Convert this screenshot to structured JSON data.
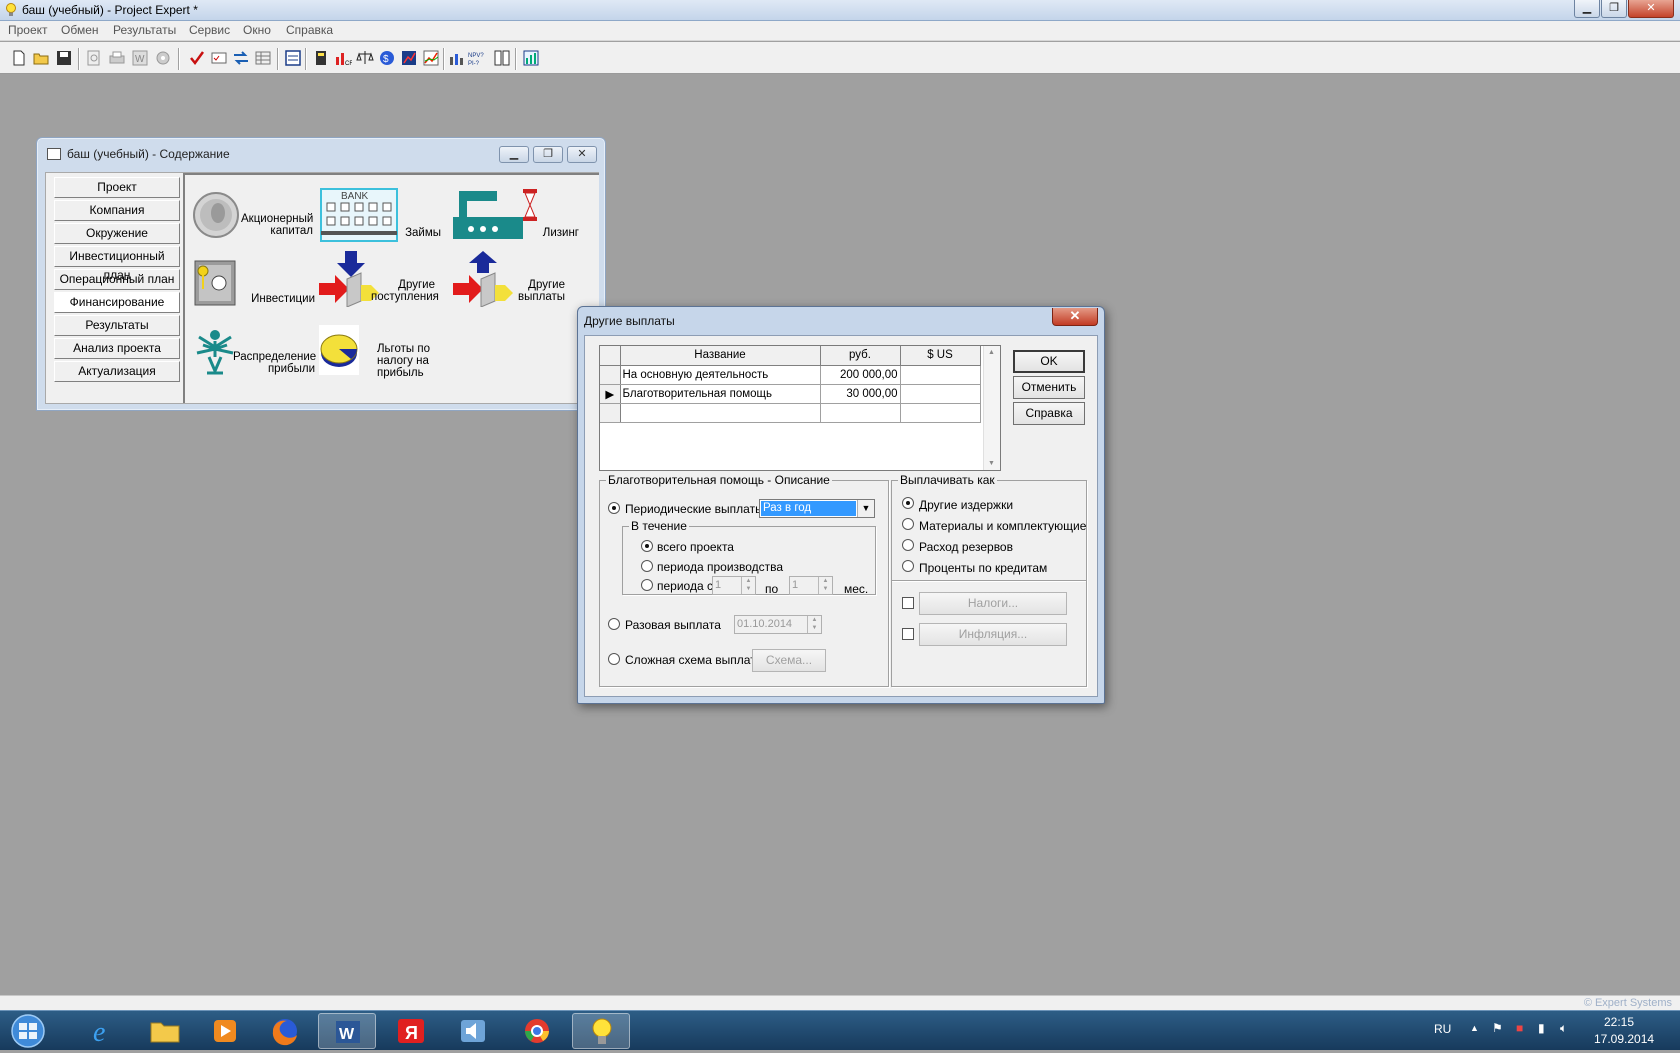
{
  "app": {
    "title": "баш (учебный) - Project Expert *",
    "menu": [
      "Проект",
      "Обмен",
      "Результаты",
      "Сервис",
      "Окно",
      "Справка"
    ],
    "copyright": "© Expert Systems"
  },
  "content_window": {
    "title": "баш (учебный) - Содержание",
    "nav": [
      "Проект",
      "Компания",
      "Окружение",
      "Инвестиционный план",
      "Операционный план",
      "Финансирование",
      "Результаты",
      "Анализ проекта",
      "Актуализация"
    ],
    "active_nav": "Финансирование",
    "tiles": {
      "equity": "Акционерный капитал",
      "loans": "Займы",
      "leasing": "Лизинг",
      "investments": "Инвестиции",
      "other_income": "Другие поступления",
      "other_payments": "Другие выплаты",
      "profit_distribution": "Распределение прибыли",
      "tax_benefits": "Льготы по налогу на прибыль"
    }
  },
  "dialog": {
    "title": "Другие выплаты",
    "grid": {
      "headers": [
        "Название",
        "руб.",
        "$ US"
      ],
      "rows": [
        {
          "name": "На основную деятельность",
          "rub": "200 000,00",
          "usd": ""
        },
        {
          "name": "Благотворительная помощь",
          "rub": "30 000,00",
          "usd": ""
        }
      ],
      "selected_row": 1
    },
    "buttons": {
      "ok": "OK",
      "cancel": "Отменить",
      "help": "Справка"
    },
    "description": {
      "legend": "Благотворительная помощь - Описание",
      "periodic_label": "Периодические выплаты",
      "periodic_value": "Раз в год",
      "periodic_checked": true,
      "during_legend": "В течение",
      "whole_project": "всего проекта",
      "production_period": "периода производства",
      "period_from": "периода с",
      "from_value": "1",
      "to_label": "по",
      "to_value": "1",
      "months": "мес.",
      "one_time_label": "Разовая выплата",
      "one_time_date": "01.10.2014",
      "complex_label": "Сложная схема выплат",
      "scheme_button": "Схема..."
    },
    "pay_as": {
      "legend": "Выплачивать как",
      "options": [
        "Другие издержки",
        "Материалы и комплектующие",
        "Расход резервов",
        "Проценты по кредитам"
      ],
      "selected": 0,
      "taxes_button": "Налоги...",
      "inflation_button": "Инфляция..."
    }
  },
  "taskbar": {
    "lang": "RU",
    "time": "22:15",
    "date": "17.09.2014"
  }
}
